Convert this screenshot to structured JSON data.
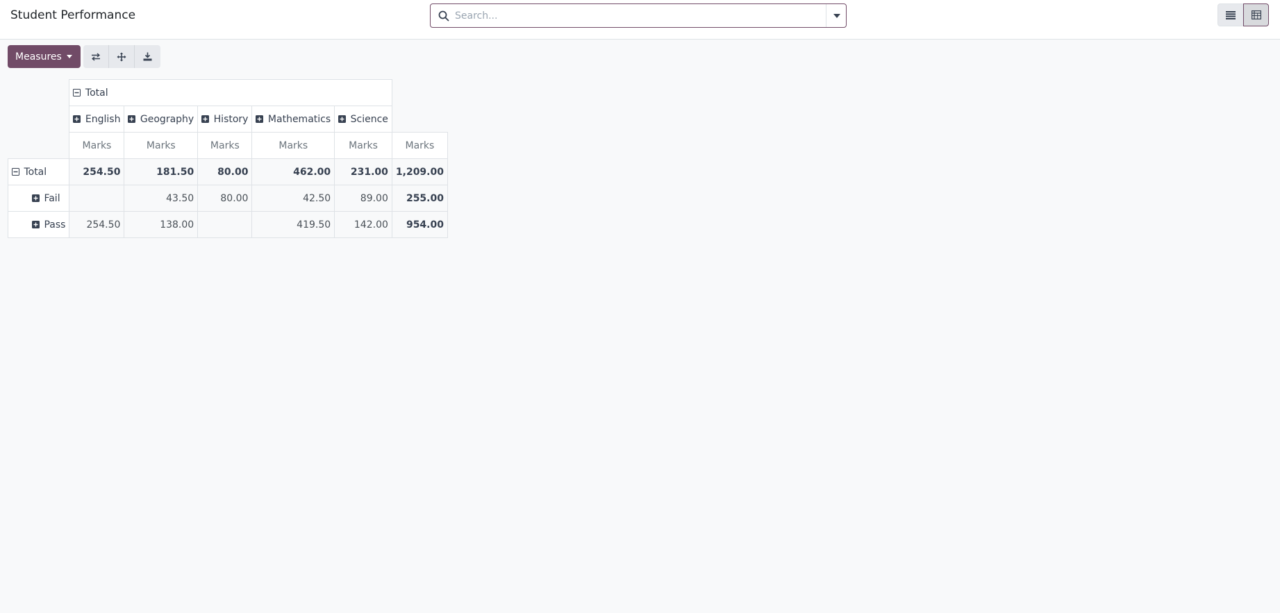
{
  "header": {
    "title": "Student Performance",
    "search": {
      "placeholder": "Search..."
    }
  },
  "toolbar": {
    "measures_label": "Measures"
  },
  "pivot": {
    "column_group_label": "Total",
    "columns": [
      {
        "label": "English"
      },
      {
        "label": "Geography"
      },
      {
        "label": "History"
      },
      {
        "label": "Mathematics"
      },
      {
        "label": "Science"
      }
    ],
    "measure_label": "Marks",
    "rows": [
      {
        "label": "Total",
        "values": [
          "254.50",
          "181.50",
          "80.00",
          "462.00",
          "231.00"
        ],
        "total": "1,209.00"
      },
      {
        "label": "Fail",
        "values": [
          "",
          "43.50",
          "80.00",
          "42.50",
          "89.00"
        ],
        "total": "255.00"
      },
      {
        "label": "Pass",
        "values": [
          "254.50",
          "138.00",
          "",
          "419.50",
          "142.00"
        ],
        "total": "954.00"
      }
    ]
  },
  "colors": {
    "accent": "#714b67",
    "border": "#dee2e6"
  }
}
